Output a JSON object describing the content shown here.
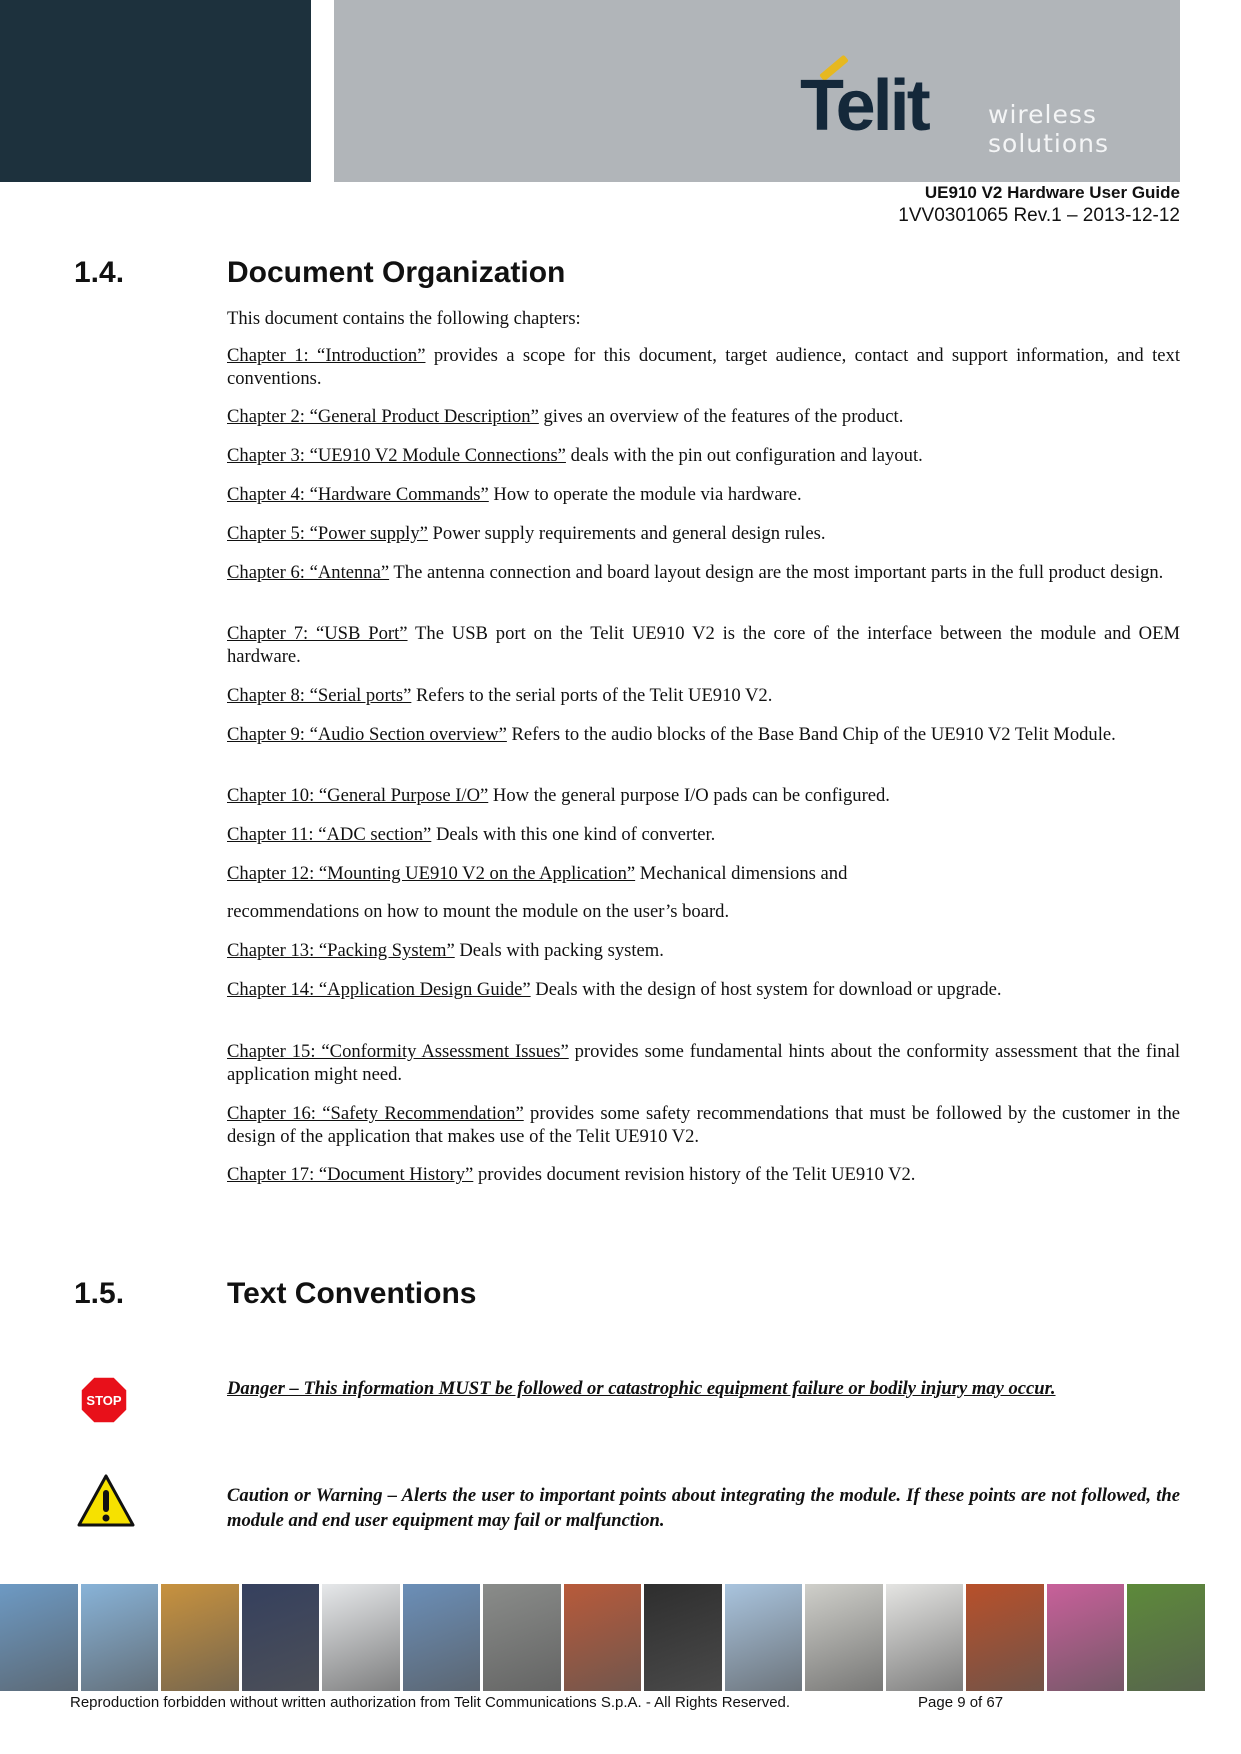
{
  "header": {
    "brand": "Telit",
    "brand_sub_1": "wireless",
    "brand_sub_2": "solutions",
    "doc_title": "UE910 V2 Hardware User Guide",
    "doc_revision": "1VV0301065 Rev.1 – 2013-12-12",
    "colors": {
      "dark_block": "#1d313d",
      "grey_block": "#b1b5b9",
      "logo_text": "#14283a",
      "logo_accent": "#e6b820"
    }
  },
  "section_1_4": {
    "number": "1.4.",
    "title": "Document Organization",
    "intro": "This document contains the following chapters:",
    "chapters": [
      {
        "link": "Chapter 1: “Introduction”",
        "text": " provides a scope for this document, target audience, contact and support information, and text conventions."
      },
      {
        "link": "Chapter 2: “General Product Description”",
        "text": " gives an overview of the features of the product."
      },
      {
        "link": "Chapter 3: “UE910 V2 Module Connections”",
        "text": " deals with the pin out configuration and layout."
      },
      {
        "link": "Chapter 4: “Hardware Commands”",
        "text": " How to operate the module via hardware."
      },
      {
        "link": "Chapter 5: “Power supply”",
        "text": " Power supply requirements and general design rules."
      },
      {
        "link": "Chapter 6: “Antenna”",
        "text": " The antenna connection and board layout design are the most important parts in the full product design."
      },
      {
        "link": "Chapter 7: “USB Port”",
        "text": " The USB port on the Telit UE910 V2 is the core of the interface between the module and OEM hardware."
      },
      {
        "link": "Chapter 8: “Serial ports”",
        "text": " Refers to the serial ports of the Telit UE910 V2."
      },
      {
        "link": "Chapter 9: “Audio Section overview”",
        "text": " Refers to the audio blocks of the Base Band Chip of the UE910 V2 Telit Module."
      },
      {
        "link": "Chapter 10: “General Purpose I/O”",
        "text": " How the general purpose I/O pads can be configured."
      },
      {
        "link": "Chapter 11: “ADC section”",
        "text": " Deals with this one kind of converter."
      },
      {
        "link": "Chapter 12: “Mounting UE910 V2 on the Application”",
        "text": " Mechanical dimensions and"
      },
      {
        "link": "",
        "text": "recommendations on how to mount the module on the user’s board."
      },
      {
        "link": "Chapter 13: “Packing System”",
        "text": " Deals with packing system."
      },
      {
        "link": "Chapter 14: “Application Design Guide”",
        "text": " Deals with the design of host system for download or upgrade."
      },
      {
        "link": "Chapter 15: “Conformity Assessment Issues”",
        "text": " provides some fundamental hints about the conformity assessment that the final application might need."
      },
      {
        "link": "Chapter 16: “Safety Recommendation”",
        "text": " provides some safety recommendations that must be followed by the customer in the design of the application that makes use of the Telit UE910 V2."
      },
      {
        "link": "Chapter 17: “Document History”",
        "text": " provides document revision history of the Telit UE910 V2."
      }
    ]
  },
  "section_1_5": {
    "number": "1.5.",
    "title": "Text Conventions",
    "danger": {
      "icon": "stop-sign-icon",
      "icon_text": "STOP",
      "text": "Danger – This information MUST be followed or catastrophic equipment failure or bodily injury may occur."
    },
    "caution": {
      "icon": "warning-triangle-icon",
      "text": "Caution or Warning – Alerts the user to important points about integrating the module. If these points are not followed, the module and end user equipment may fail or malfunction."
    }
  },
  "footer": {
    "photos": [
      "coast",
      "sos-phone",
      "containers",
      "clock-display",
      "laptop",
      "cyclist",
      "card-reader",
      "vending-machine",
      "payment-terminal",
      "wind-turbines",
      "electric-meter",
      "building-facade",
      "subway-train",
      "textile-rolls",
      "security-camera"
    ],
    "copyright": "Reproduction forbidden without written authorization from Telit Communications S.p.A. - All Rights Reserved.",
    "page": "Page 9 of 67"
  }
}
